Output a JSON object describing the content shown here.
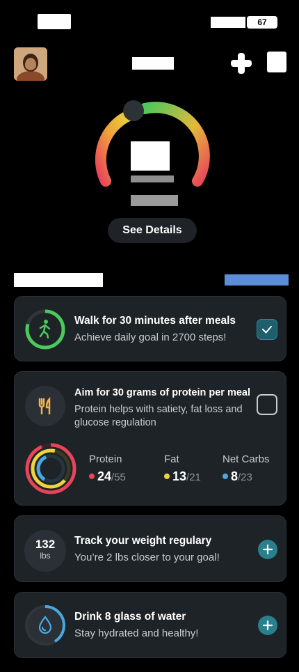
{
  "status_bar": {
    "battery": "67"
  },
  "header": {},
  "score": {
    "see_details_label": "See Details"
  },
  "cards": [
    {
      "title": "Walk for 30 minutes after meals",
      "subtitle": "Achieve daily goal in 2700 steps!",
      "checked": true,
      "icon": "walking-person-icon",
      "accent": "#4cc95b"
    },
    {
      "title": "Aim for 30 grams of protein per meal",
      "subtitle": "Protein helps with satiety, fat loss and glucose regulation",
      "checked": false,
      "icon": "fork-knife-icon",
      "accent": "#f0b24b",
      "macros": [
        {
          "label": "Protein",
          "value": "24",
          "total": "/55",
          "color": "#e8445a"
        },
        {
          "label": "Fat",
          "value": "13",
          "total": "/21",
          "color": "#ecd53c"
        },
        {
          "label": "Net Carbs",
          "value": "8",
          "total": "/23",
          "color": "#4aa8e0"
        }
      ]
    },
    {
      "value": "132",
      "unit": "lbs",
      "title": "Track your weight regulary",
      "subtitle": "You’re 2 lbs closer to your goal!",
      "icon": "plus-icon"
    },
    {
      "title": "Drink 8 glass of water",
      "subtitle": "Stay hydrated and healthy!",
      "icon": "water-drop-icon",
      "accent": "#4aa8e0"
    }
  ]
}
